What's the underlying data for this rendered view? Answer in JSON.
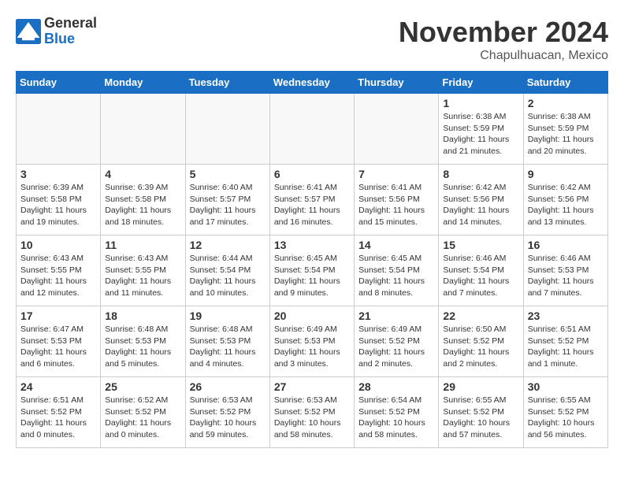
{
  "header": {
    "logo_general": "General",
    "logo_blue": "Blue",
    "month_title": "November 2024",
    "location": "Chapulhuacan, Mexico"
  },
  "weekdays": [
    "Sunday",
    "Monday",
    "Tuesday",
    "Wednesday",
    "Thursday",
    "Friday",
    "Saturday"
  ],
  "weeks": [
    [
      {
        "day": "",
        "info": ""
      },
      {
        "day": "",
        "info": ""
      },
      {
        "day": "",
        "info": ""
      },
      {
        "day": "",
        "info": ""
      },
      {
        "day": "",
        "info": ""
      },
      {
        "day": "1",
        "info": "Sunrise: 6:38 AM\nSunset: 5:59 PM\nDaylight: 11 hours\nand 21 minutes."
      },
      {
        "day": "2",
        "info": "Sunrise: 6:38 AM\nSunset: 5:59 PM\nDaylight: 11 hours\nand 20 minutes."
      }
    ],
    [
      {
        "day": "3",
        "info": "Sunrise: 6:39 AM\nSunset: 5:58 PM\nDaylight: 11 hours\nand 19 minutes."
      },
      {
        "day": "4",
        "info": "Sunrise: 6:39 AM\nSunset: 5:58 PM\nDaylight: 11 hours\nand 18 minutes."
      },
      {
        "day": "5",
        "info": "Sunrise: 6:40 AM\nSunset: 5:57 PM\nDaylight: 11 hours\nand 17 minutes."
      },
      {
        "day": "6",
        "info": "Sunrise: 6:41 AM\nSunset: 5:57 PM\nDaylight: 11 hours\nand 16 minutes."
      },
      {
        "day": "7",
        "info": "Sunrise: 6:41 AM\nSunset: 5:56 PM\nDaylight: 11 hours\nand 15 minutes."
      },
      {
        "day": "8",
        "info": "Sunrise: 6:42 AM\nSunset: 5:56 PM\nDaylight: 11 hours\nand 14 minutes."
      },
      {
        "day": "9",
        "info": "Sunrise: 6:42 AM\nSunset: 5:56 PM\nDaylight: 11 hours\nand 13 minutes."
      }
    ],
    [
      {
        "day": "10",
        "info": "Sunrise: 6:43 AM\nSunset: 5:55 PM\nDaylight: 11 hours\nand 12 minutes."
      },
      {
        "day": "11",
        "info": "Sunrise: 6:43 AM\nSunset: 5:55 PM\nDaylight: 11 hours\nand 11 minutes."
      },
      {
        "day": "12",
        "info": "Sunrise: 6:44 AM\nSunset: 5:54 PM\nDaylight: 11 hours\nand 10 minutes."
      },
      {
        "day": "13",
        "info": "Sunrise: 6:45 AM\nSunset: 5:54 PM\nDaylight: 11 hours\nand 9 minutes."
      },
      {
        "day": "14",
        "info": "Sunrise: 6:45 AM\nSunset: 5:54 PM\nDaylight: 11 hours\nand 8 minutes."
      },
      {
        "day": "15",
        "info": "Sunrise: 6:46 AM\nSunset: 5:54 PM\nDaylight: 11 hours\nand 7 minutes."
      },
      {
        "day": "16",
        "info": "Sunrise: 6:46 AM\nSunset: 5:53 PM\nDaylight: 11 hours\nand 7 minutes."
      }
    ],
    [
      {
        "day": "17",
        "info": "Sunrise: 6:47 AM\nSunset: 5:53 PM\nDaylight: 11 hours\nand 6 minutes."
      },
      {
        "day": "18",
        "info": "Sunrise: 6:48 AM\nSunset: 5:53 PM\nDaylight: 11 hours\nand 5 minutes."
      },
      {
        "day": "19",
        "info": "Sunrise: 6:48 AM\nSunset: 5:53 PM\nDaylight: 11 hours\nand 4 minutes."
      },
      {
        "day": "20",
        "info": "Sunrise: 6:49 AM\nSunset: 5:53 PM\nDaylight: 11 hours\nand 3 minutes."
      },
      {
        "day": "21",
        "info": "Sunrise: 6:49 AM\nSunset: 5:52 PM\nDaylight: 11 hours\nand 2 minutes."
      },
      {
        "day": "22",
        "info": "Sunrise: 6:50 AM\nSunset: 5:52 PM\nDaylight: 11 hours\nand 2 minutes."
      },
      {
        "day": "23",
        "info": "Sunrise: 6:51 AM\nSunset: 5:52 PM\nDaylight: 11 hours\nand 1 minute."
      }
    ],
    [
      {
        "day": "24",
        "info": "Sunrise: 6:51 AM\nSunset: 5:52 PM\nDaylight: 11 hours\nand 0 minutes."
      },
      {
        "day": "25",
        "info": "Sunrise: 6:52 AM\nSunset: 5:52 PM\nDaylight: 11 hours\nand 0 minutes."
      },
      {
        "day": "26",
        "info": "Sunrise: 6:53 AM\nSunset: 5:52 PM\nDaylight: 10 hours\nand 59 minutes."
      },
      {
        "day": "27",
        "info": "Sunrise: 6:53 AM\nSunset: 5:52 PM\nDaylight: 10 hours\nand 58 minutes."
      },
      {
        "day": "28",
        "info": "Sunrise: 6:54 AM\nSunset: 5:52 PM\nDaylight: 10 hours\nand 58 minutes."
      },
      {
        "day": "29",
        "info": "Sunrise: 6:55 AM\nSunset: 5:52 PM\nDaylight: 10 hours\nand 57 minutes."
      },
      {
        "day": "30",
        "info": "Sunrise: 6:55 AM\nSunset: 5:52 PM\nDaylight: 10 hours\nand 56 minutes."
      }
    ]
  ]
}
